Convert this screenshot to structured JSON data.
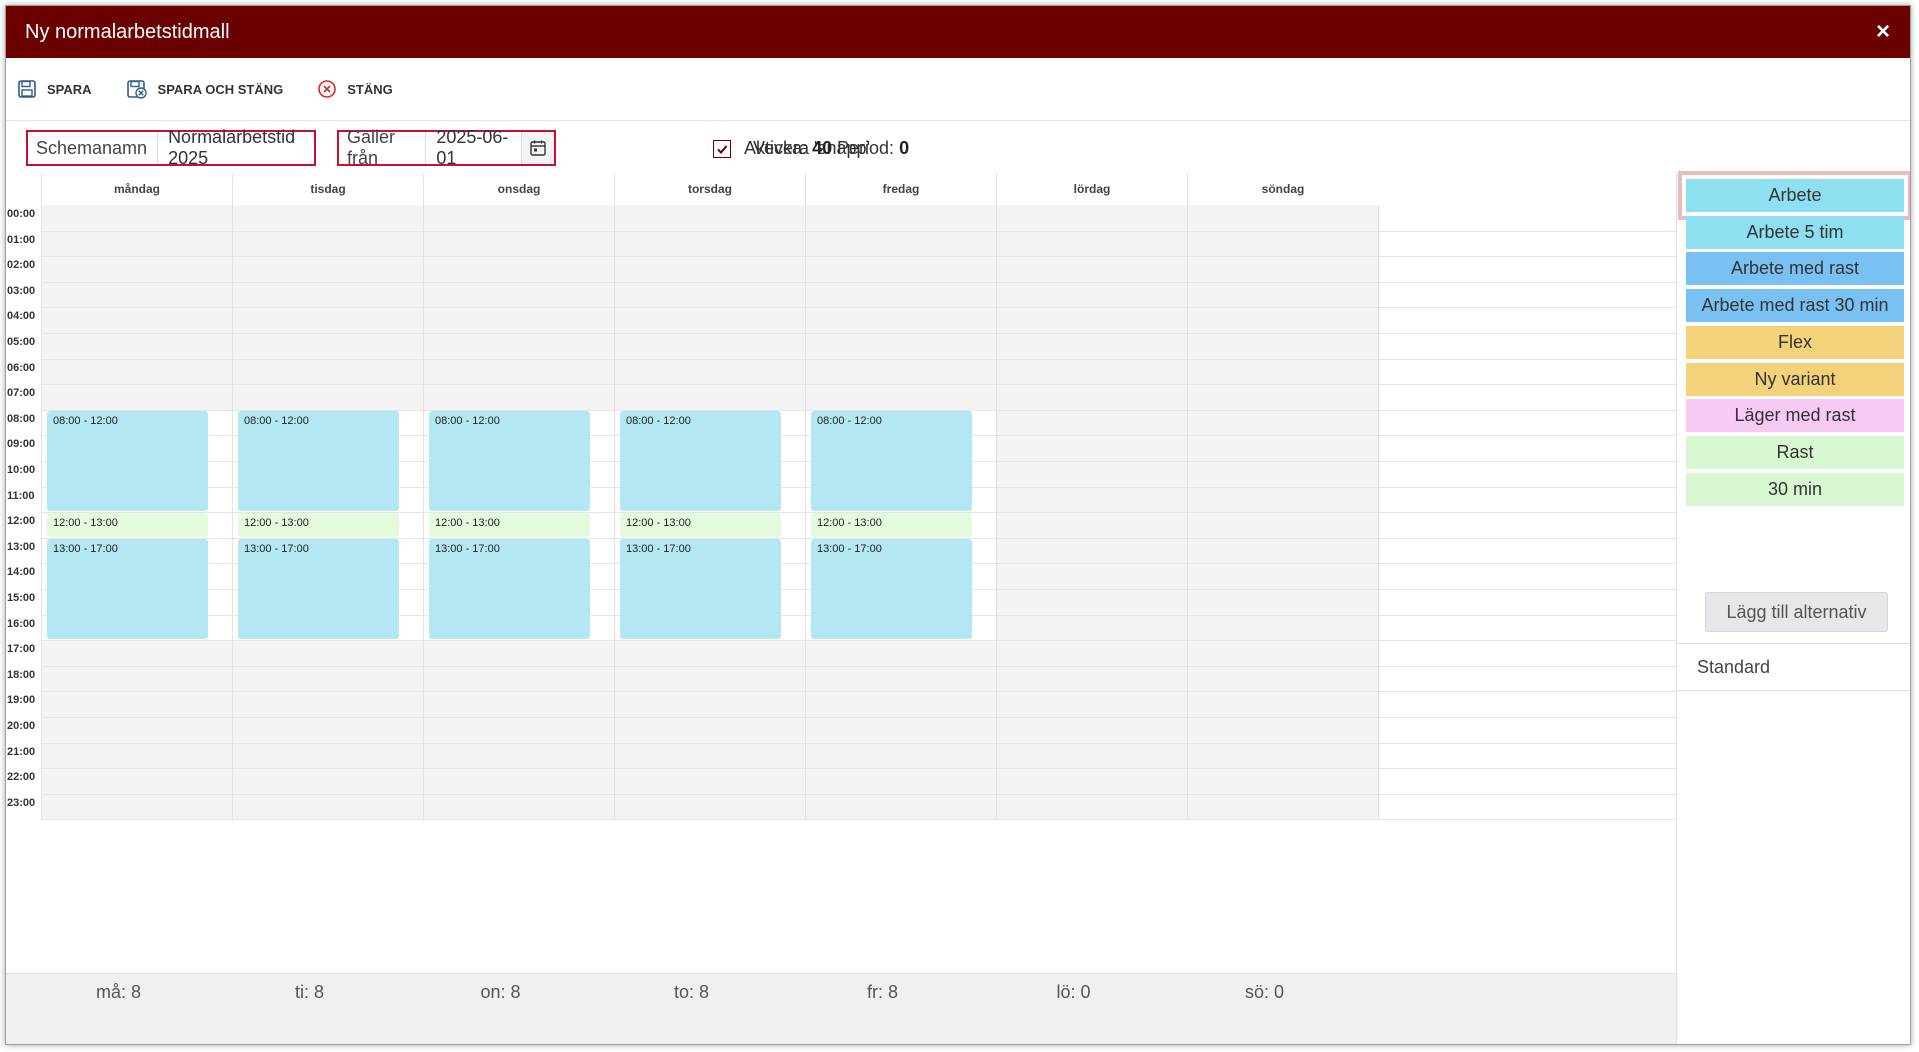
{
  "window": {
    "title": "Ny normalarbetstidmall",
    "close_icon": "×"
  },
  "toolbar": {
    "save_label": "SPARA",
    "save_close_label": "SPARA OCH STÄNG",
    "close_label": "STÄNG"
  },
  "form": {
    "schema_name_label": "Schemanamn",
    "schema_name_value": "Normalarbetstid 2025",
    "valid_from_label": "Gäller från",
    "valid_from_value": "2025-06-01",
    "snap_label": "Aktivera 'snapp'",
    "snap_checked": true,
    "week_label": "Vecka:",
    "week_value": "40",
    "period_label": "Period:",
    "period_value": "0"
  },
  "calendar": {
    "days": [
      "måndag",
      "tisdag",
      "onsdag",
      "torsdag",
      "fredag",
      "lördag",
      "söndag"
    ],
    "hours": [
      "00:00",
      "01:00",
      "02:00",
      "03:00",
      "04:00",
      "05:00",
      "06:00",
      "07:00",
      "08:00",
      "09:00",
      "10:00",
      "11:00",
      "12:00",
      "13:00",
      "14:00",
      "15:00",
      "16:00",
      "17:00",
      "18:00",
      "19:00",
      "20:00",
      "21:00",
      "22:00",
      "23:00"
    ],
    "events": [
      {
        "day": 0,
        "label": "08:00 - 12:00",
        "start": 8,
        "end": 12,
        "kind": "work"
      },
      {
        "day": 0,
        "label": "12:00 - 13:00",
        "start": 12,
        "end": 13,
        "kind": "break"
      },
      {
        "day": 0,
        "label": "13:00 - 17:00",
        "start": 13,
        "end": 17,
        "kind": "work"
      },
      {
        "day": 1,
        "label": "08:00 - 12:00",
        "start": 8,
        "end": 12,
        "kind": "work"
      },
      {
        "day": 1,
        "label": "12:00 - 13:00",
        "start": 12,
        "end": 13,
        "kind": "break"
      },
      {
        "day": 1,
        "label": "13:00 - 17:00",
        "start": 13,
        "end": 17,
        "kind": "work"
      },
      {
        "day": 2,
        "label": "08:00 - 12:00",
        "start": 8,
        "end": 12,
        "kind": "work"
      },
      {
        "day": 2,
        "label": "12:00 - 13:00",
        "start": 12,
        "end": 13,
        "kind": "break"
      },
      {
        "day": 2,
        "label": "13:00 - 17:00",
        "start": 13,
        "end": 17,
        "kind": "work"
      },
      {
        "day": 3,
        "label": "08:00 - 12:00",
        "start": 8,
        "end": 12,
        "kind": "work"
      },
      {
        "day": 3,
        "label": "12:00 - 13:00",
        "start": 12,
        "end": 13,
        "kind": "break"
      },
      {
        "day": 3,
        "label": "13:00 - 17:00",
        "start": 13,
        "end": 17,
        "kind": "work"
      },
      {
        "day": 4,
        "label": "08:00 - 12:00",
        "start": 8,
        "end": 12,
        "kind": "work"
      },
      {
        "day": 4,
        "label": "12:00 - 13:00",
        "start": 12,
        "end": 13,
        "kind": "break"
      },
      {
        "day": 4,
        "label": "13:00 - 17:00",
        "start": 13,
        "end": 17,
        "kind": "work"
      }
    ],
    "totals": [
      "må: 8",
      "ti: 8",
      "on: 8",
      "to: 8",
      "fr: 8",
      "lö: 0",
      "sö: 0"
    ]
  },
  "sidebar": {
    "options": [
      {
        "label": "Arbete",
        "color": "#8ee0f0",
        "selected": true
      },
      {
        "label": "Arbete 5 tim",
        "color": "#8ee0f0"
      },
      {
        "label": "Arbete med rast",
        "color": "#79c1f3"
      },
      {
        "label": "Arbete med rast 30 min",
        "color": "#79c1f3"
      },
      {
        "label": "Flex",
        "color": "#f3d27a"
      },
      {
        "label": "Ny variant",
        "color": "#f3d27a"
      },
      {
        "label": "Läger med rast",
        "color": "#f7c9f5"
      },
      {
        "label": "Rast",
        "color": "#d7f8d0"
      },
      {
        "label": "30 min",
        "color": "#d7f8d0"
      }
    ],
    "add_button_label": "Lägg till alternativ",
    "standard_label": "Standard"
  },
  "colors": {
    "titlebar": "#6b0000",
    "work": "#b3e8f2",
    "break": "#e2fbdc",
    "highlight_border": "#c8102e"
  }
}
